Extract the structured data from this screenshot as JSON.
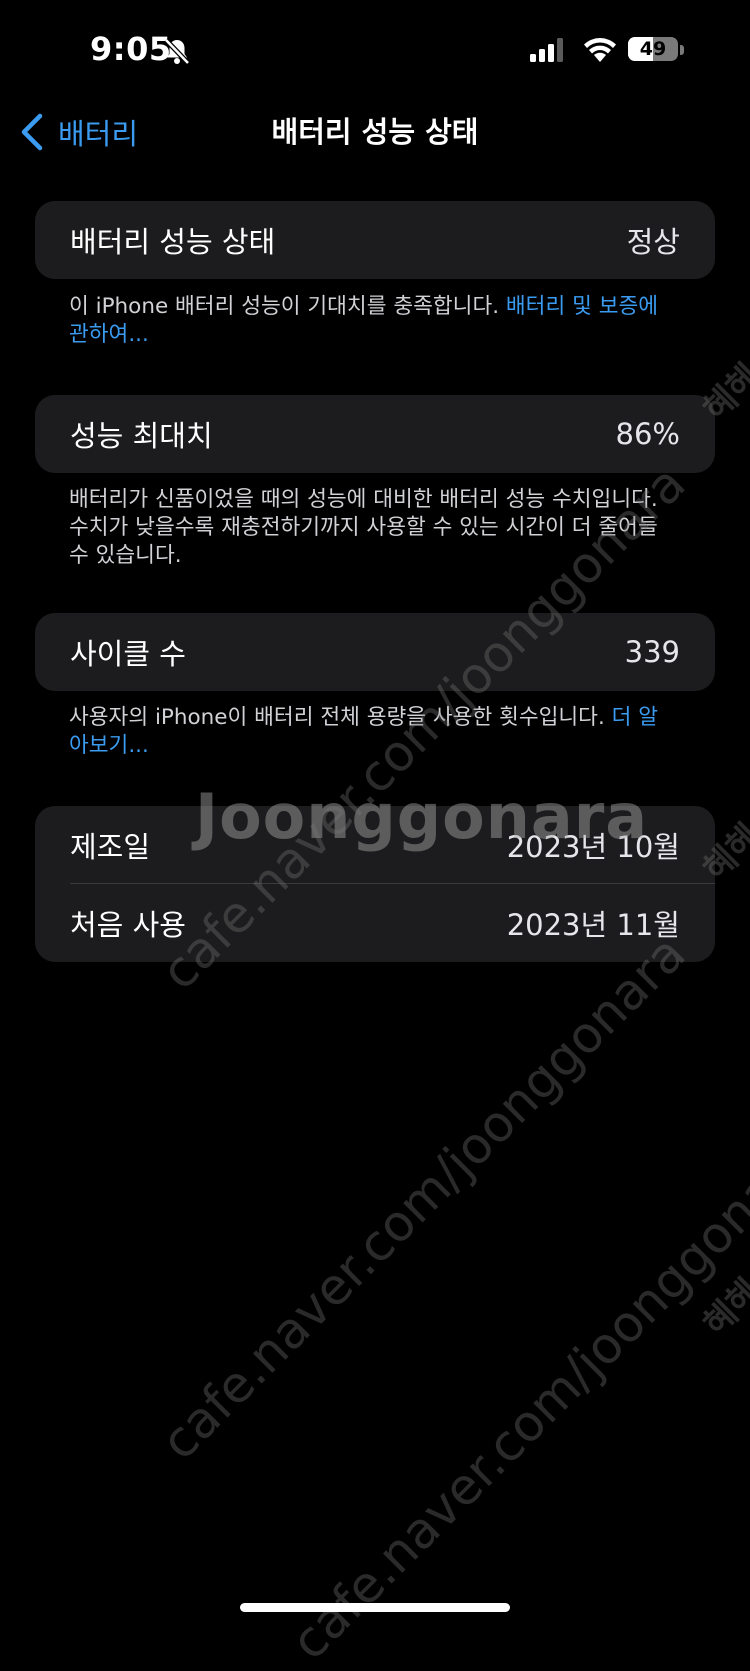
{
  "status_bar": {
    "time": "9:05",
    "battery_percent": "49",
    "battery_level": 0.49
  },
  "nav": {
    "back_label": "배터리",
    "title": "배터리 성능 상태"
  },
  "health": {
    "label": "배터리 성능 상태",
    "value": "정상",
    "footer_text": "이 iPhone 배터리 성능이 기대치를 충족합니다. ",
    "footer_link": "배터리 및 보증에 관하여..."
  },
  "max_capacity": {
    "label": "성능 최대치",
    "value": "86%",
    "footer_text": "배터리가 신품이었을 때의 성능에 대비한 배터리 성능 수치입니다. 수치가 낮을수록 재충전하기까지 사용할 수 있는 시간이 더 줄어들 수 있습니다."
  },
  "cycle_count": {
    "label": "사이클 수",
    "value": "339",
    "footer_text": "사용자의 iPhone이 배터리 전체 용량을 사용한 횟수입니다. ",
    "footer_link": "더 알아보기..."
  },
  "dates": [
    {
      "label": "제조일",
      "value": "2023년 10월"
    },
    {
      "label": "처음 사용",
      "value": "2023년 11월"
    }
  ],
  "watermark": {
    "logo": "Joonggonara",
    "diagonal_1": "cafe.naver.com/joonggonara",
    "diagonal_2": "cafe.naver.com/joonggonara",
    "diagonal_3": "cafe.naver.com/joonggonara",
    "side": "혜헤"
  },
  "colors": {
    "accent": "#3a9bf0",
    "background": "#000000",
    "cell": "#1c1c1e"
  }
}
